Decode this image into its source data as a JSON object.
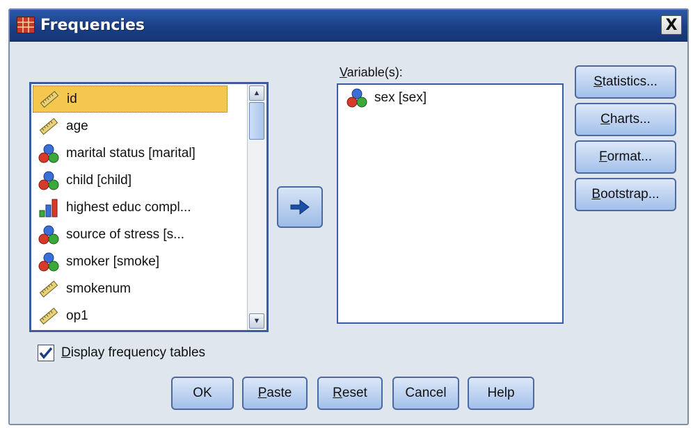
{
  "window": {
    "title": "Frequencies",
    "close_glyph": "X"
  },
  "source_list": {
    "items": [
      {
        "label": "id",
        "icon": "scale-ruler-icon",
        "selected": true
      },
      {
        "label": "age",
        "icon": "scale-ruler-icon"
      },
      {
        "label": "marital status [marital]",
        "icon": "nominal-balls-icon"
      },
      {
        "label": "child [child]",
        "icon": "nominal-balls-icon"
      },
      {
        "label": "highest educ compl...",
        "icon": "ordinal-bars-icon"
      },
      {
        "label": "source of stress [s...",
        "icon": "nominal-balls-icon"
      },
      {
        "label": "smoker [smoke]",
        "icon": "nominal-balls-icon"
      },
      {
        "label": "smokenum",
        "icon": "scale-ruler-icon"
      },
      {
        "label": "op1",
        "icon": "scale-ruler-icon"
      }
    ]
  },
  "target": {
    "label_prefix": "V",
    "label_rest": "ariable(s):",
    "items": [
      {
        "label": "sex [sex]",
        "icon": "nominal-balls-icon"
      }
    ]
  },
  "buttons": {
    "statistics": {
      "u": "S",
      "rest": "tatistics..."
    },
    "charts": {
      "pre": "",
      "u": "C",
      "rest": "harts..."
    },
    "format": {
      "u": "F",
      "rest": "ormat..."
    },
    "bootstrap": {
      "u": "B",
      "rest": "ootstrap..."
    },
    "ok": "OK",
    "paste": {
      "u": "P",
      "rest": "aste"
    },
    "reset": {
      "u": "R",
      "rest": "eset"
    },
    "cancel": "Cancel",
    "help": "Help"
  },
  "checkbox": {
    "checked": true,
    "u": "D",
    "rest": "isplay frequency tables"
  },
  "colors": {
    "title_bar": "#1a3f86",
    "selection": "#f4c84f",
    "button_face": "#a3c0ea",
    "arrow": "#1d4fa6"
  }
}
